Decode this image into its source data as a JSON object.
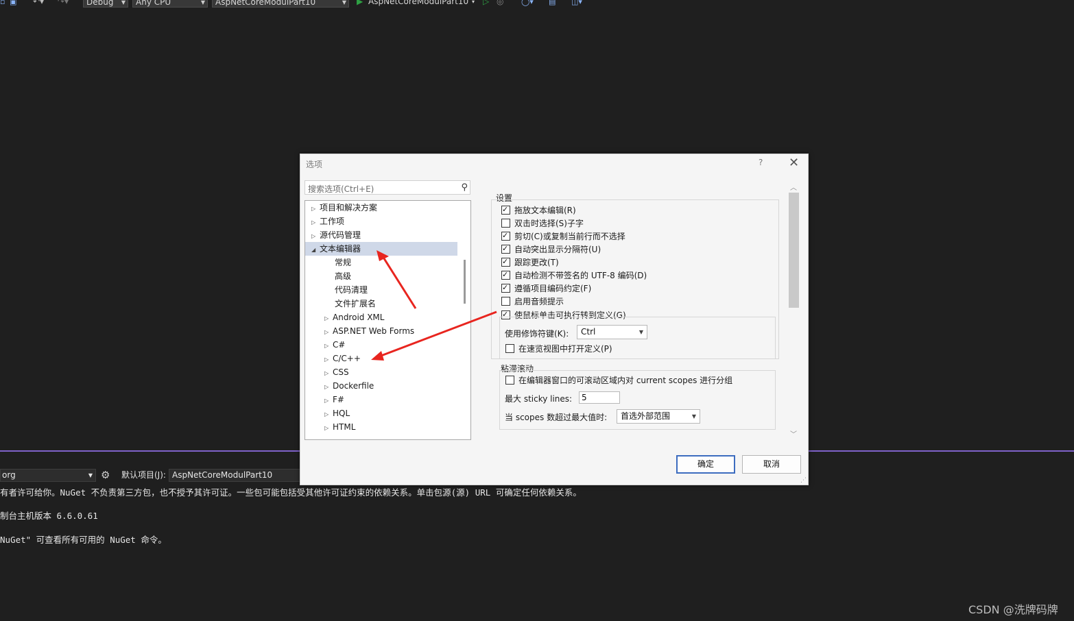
{
  "toolbar": {
    "config": "Debug",
    "platform": "Any CPU",
    "startup_project": "AspNetCoreModulPart10",
    "run_target": "AspNetCoreModulPart10"
  },
  "package_manager": {
    "source": "org",
    "default_project_label": "默认项目(J):",
    "default_project": "AspNetCoreModulPart10",
    "console_lines": [
      "有者许可给你。NuGet 不负责第三方包，也不授予其许可证。一些包可能包括受其他许可证约束的依赖关系。单击包源(源) URL 可确定任何依赖关系。",
      "制台主机版本 6.6.0.61",
      " NuGet\" 可查看所有可用的 NuGet 命令。"
    ]
  },
  "watermark": "CSDN @洗牌码牌",
  "dialog": {
    "title": "选项",
    "help": "?",
    "search_placeholder": "搜索选项(Ctrl+E)",
    "tree": [
      {
        "label": "项目和解决方案",
        "level": 0,
        "expander": "▷",
        "selected": false
      },
      {
        "label": "工作项",
        "level": 0,
        "expander": "▷",
        "selected": false
      },
      {
        "label": "源代码管理",
        "level": 0,
        "expander": "▷",
        "selected": false
      },
      {
        "label": "文本编辑器",
        "level": 0,
        "expander": "◢",
        "selected": true
      },
      {
        "label": "常规",
        "level": 1,
        "expander": "",
        "selected": false
      },
      {
        "label": "高级",
        "level": 1,
        "expander": "",
        "selected": false
      },
      {
        "label": "代码清理",
        "level": 1,
        "expander": "",
        "selected": false
      },
      {
        "label": "文件扩展名",
        "level": 1,
        "expander": "",
        "selected": false
      },
      {
        "label": "Android XML",
        "level": 1,
        "expander": "▷",
        "selected": false
      },
      {
        "label": "ASP.NET Web Forms",
        "level": 1,
        "expander": "▷",
        "selected": false
      },
      {
        "label": "C#",
        "level": 1,
        "expander": "▷",
        "selected": false
      },
      {
        "label": "C/C++",
        "level": 1,
        "expander": "▷",
        "selected": false
      },
      {
        "label": "CSS",
        "level": 1,
        "expander": "▷",
        "selected": false
      },
      {
        "label": "Dockerfile",
        "level": 1,
        "expander": "▷",
        "selected": false
      },
      {
        "label": "F#",
        "level": 1,
        "expander": "▷",
        "selected": false
      },
      {
        "label": "HQL",
        "level": 1,
        "expander": "▷",
        "selected": false
      },
      {
        "label": "HTML",
        "level": 1,
        "expander": "▷",
        "selected": false
      }
    ],
    "settings_group_label": "设置",
    "settings": [
      {
        "label": "拖放文本编辑(R)",
        "checked": true
      },
      {
        "label": "双击时选择(S)子字",
        "checked": false
      },
      {
        "label": "剪切(C)或复制当前行而不选择",
        "checked": true
      },
      {
        "label": "自动突出显示分隔符(U)",
        "checked": true
      },
      {
        "label": "跟踪更改(T)",
        "checked": true
      },
      {
        "label": "自动检测不带签名的 UTF-8 编码(D)",
        "checked": true
      },
      {
        "label": "遵循项目编码约定(F)",
        "checked": true
      },
      {
        "label": "启用音频提示",
        "checked": false
      },
      {
        "label": "使鼠标单击可执行转到定义(G)",
        "checked": true
      }
    ],
    "modifier_label": "使用修饰符键(K):",
    "modifier_value": "Ctrl",
    "peek_label": "在速览视图中打开定义(P)",
    "peek_checked": false,
    "sticky_group_label": "粘滞滚动",
    "sticky_group_scopes_label": "在编辑器窗口的可滚动区域内对 current scopes 进行分组",
    "sticky_group_scopes_checked": false,
    "max_sticky_label": "最大 sticky lines:",
    "max_sticky_value": "5",
    "exceed_label": "当 scopes 数超过最大值时:",
    "exceed_value": "首选外部范围",
    "ok_label": "确定",
    "cancel_label": "取消"
  },
  "colors": {
    "accent_purple": "#7f62c9",
    "annotation_red": "#e8251f",
    "primary_button_border": "#3c6cbf"
  }
}
